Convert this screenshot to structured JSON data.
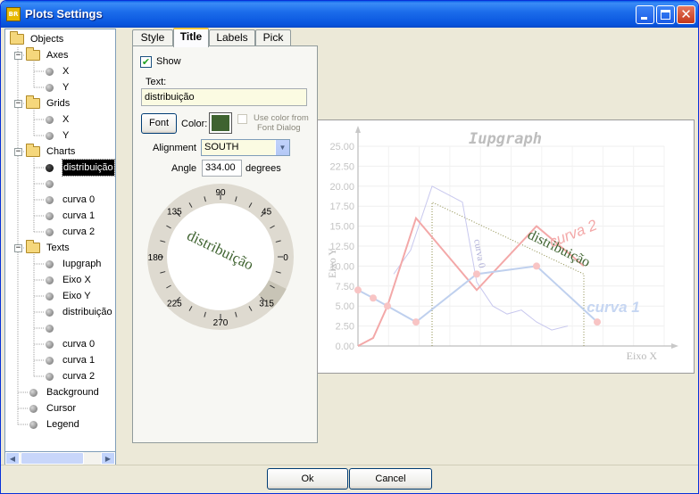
{
  "window": {
    "title": "Plots Settings",
    "icon_text": "BR"
  },
  "tree": {
    "rows": [
      {
        "label": "Objects",
        "kind": "folder",
        "level": 0
      },
      {
        "label": "Axes",
        "kind": "folder",
        "level": 1
      },
      {
        "label": "X",
        "kind": "item",
        "level": 2
      },
      {
        "label": "Y",
        "kind": "item",
        "level": 2
      },
      {
        "label": "Grids",
        "kind": "folder",
        "level": 1
      },
      {
        "label": "X",
        "kind": "item",
        "level": 2
      },
      {
        "label": "Y",
        "kind": "item",
        "level": 2
      },
      {
        "label": "Charts",
        "kind": "folder",
        "level": 1
      },
      {
        "label": "distribuição",
        "kind": "item",
        "level": 2,
        "selected": true
      },
      {
        "label": "",
        "kind": "item",
        "level": 2
      },
      {
        "label": "curva 0",
        "kind": "item",
        "level": 2
      },
      {
        "label": "curva 1",
        "kind": "item",
        "level": 2
      },
      {
        "label": "curva 2",
        "kind": "item",
        "level": 2
      },
      {
        "label": "Texts",
        "kind": "folder",
        "level": 1
      },
      {
        "label": "Iupgraph",
        "kind": "item",
        "level": 2
      },
      {
        "label": "Eixo X",
        "kind": "item",
        "level": 2
      },
      {
        "label": "Eixo Y",
        "kind": "item",
        "level": 2
      },
      {
        "label": "distribuição",
        "kind": "item",
        "level": 2
      },
      {
        "label": "",
        "kind": "item",
        "level": 2
      },
      {
        "label": "curva 0",
        "kind": "item",
        "level": 2
      },
      {
        "label": "curva 1",
        "kind": "item",
        "level": 2
      },
      {
        "label": "curva 2",
        "kind": "item",
        "level": 2
      },
      {
        "label": "Background",
        "kind": "item",
        "level": 1
      },
      {
        "label": "Cursor",
        "kind": "item",
        "level": 1
      },
      {
        "label": "Legend",
        "kind": "item",
        "level": 1
      }
    ]
  },
  "tabs": [
    "Style",
    "Title",
    "Labels",
    "Pick"
  ],
  "active_tab": "Title",
  "title_panel": {
    "show_label": "Show",
    "show_checked": true,
    "text_label": "Text:",
    "text_value": "distribuição",
    "font_button": "Font",
    "color_label": "Color:",
    "color_value": "#3F6330",
    "use_color_label_1": "Use color from",
    "use_color_label_2": "Font Dialog",
    "alignment_label": "Alignment",
    "alignment_value": "SOUTH",
    "angle_label": "Angle",
    "angle_value": "334.00",
    "angle_unit": "degrees",
    "dial_text": "distribuição",
    "dial_labels": [
      "90",
      "45",
      "0",
      "315",
      "270",
      "225",
      "180",
      "135"
    ]
  },
  "chart_data": {
    "type": "line",
    "title": "Iupgraph",
    "xlabel": "Eixo X",
    "ylabel": "Eixo Y",
    "yticks": [
      "0.00",
      "2.50",
      "5.00",
      "7.50",
      "10.00",
      "12.50",
      "15.00",
      "17.50",
      "20.00",
      "22.50",
      "25.00"
    ],
    "ylim": [
      0,
      25
    ],
    "grid": true,
    "annotations": [
      "distribuição",
      "curva 2",
      "curva 1",
      "curva 0"
    ],
    "colors": {
      "curva_0": "#C8C8EE",
      "curva_1": "#BFD0EE",
      "curva_2": "#F3A8A8",
      "distribuicao": "#8C8C4A",
      "title": "#BDBDBD"
    }
  },
  "buttons": {
    "ok": "Ok",
    "cancel": "Cancel"
  }
}
